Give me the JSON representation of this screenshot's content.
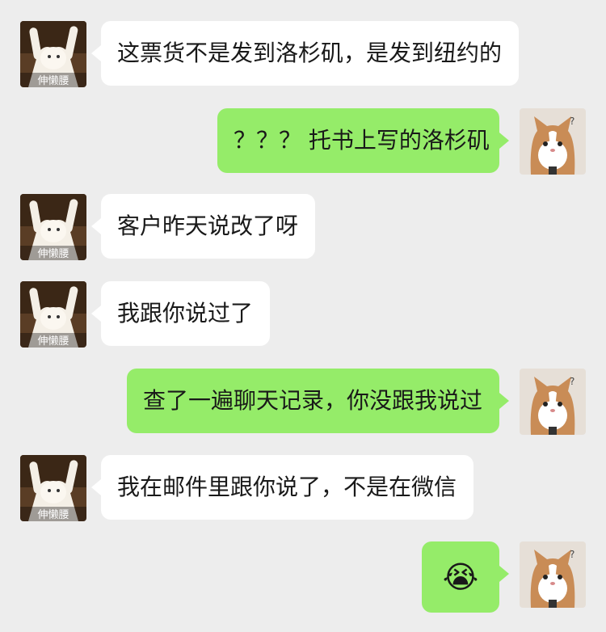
{
  "messages": [
    {
      "side": "left",
      "text": "这票货不是发到洛杉矶，是发到纽约的",
      "avatar_label": "伸懒腰"
    },
    {
      "side": "right",
      "text": "？？？ 托书上写的洛杉矶"
    },
    {
      "side": "left",
      "text": "客户昨天说改了呀",
      "avatar_label": "伸懒腰"
    },
    {
      "side": "left",
      "text": "我跟你说过了",
      "avatar_label": "伸懒腰"
    },
    {
      "side": "right",
      "text": "查了一遍聊天记录，你没跟我说过"
    },
    {
      "side": "left",
      "text": "我在邮件里跟你说了，不是在微信",
      "avatar_label": "伸懒腰"
    },
    {
      "side": "right",
      "text": "😭"
    }
  ],
  "colors": {
    "background": "#ededed",
    "incoming_bubble": "#ffffff",
    "outgoing_bubble": "#95ec69",
    "text": "#191919"
  },
  "icons": {
    "incoming_avatar": "stretching-cat-avatar-icon",
    "outgoing_avatar": "confused-cat-avatar-icon",
    "emoji": "crying-face-emoji"
  }
}
